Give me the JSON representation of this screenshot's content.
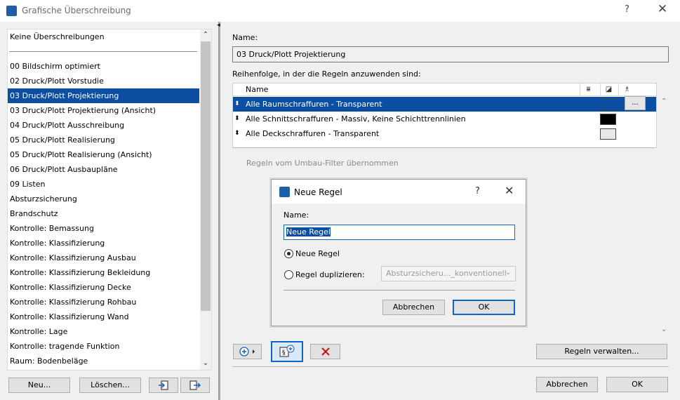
{
  "window": {
    "title": "Grafische Überschreibung",
    "help_label": "?",
    "close_label": "✕"
  },
  "left_panel": {
    "items": [
      "Keine Überschreibungen",
      "00 Bildschirm optimiert",
      "02 Druck/Plott Vorstudie",
      "03 Druck/Plott Projektierung",
      "03 Druck/Plott Projektierung (Ansicht)",
      "04 Druck/Plott Ausschreibung",
      "05 Druck/Plott Realisierung",
      "05 Druck/Plott Realisierung (Ansicht)",
      "06 Druck/Plott Ausbaupläne",
      "09 Listen",
      "Absturzsicherung",
      "Brandschutz",
      "Kontrolle: Bemassung",
      "Kontrolle: Klassifizierung",
      "Kontrolle: Klassifizierung Ausbau",
      "Kontrolle: Klassifizierung Bekleidung",
      "Kontrolle: Klassifizierung Decke",
      "Kontrolle: Klassifizierung Rohbau",
      "Kontrolle: Klassifizierung Wand",
      "Kontrolle: Lage",
      "Kontrolle: tragende Funktion",
      "Raum: Bodenbeläge"
    ],
    "selected_index": 3,
    "buttons": {
      "new": "Neu...",
      "delete": "Löschen..."
    }
  },
  "right_panel": {
    "name_label": "Name:",
    "name_value": "03 Druck/Plott Projektierung",
    "order_label": "Reihenfolge, in der die Regeln anzuwenden sind:",
    "table": {
      "header_name": "Name",
      "rows": [
        {
          "label": "Alle Raumschraffuren - Transparent",
          "swatch": "#0c4ea2"
        },
        {
          "label": "Alle Schnittschraffuren - Massiv, Keine Schichttrennlinien",
          "swatch": "#000000"
        },
        {
          "label": "Alle Deckschraffuren - Transparent",
          "swatch": "#e8e8e8"
        }
      ],
      "selected_index": 0,
      "more_label": "..."
    },
    "inherited_label": "Regeln vom Umbau-Filter übernommen",
    "manage_rules": "Regeln verwalten...",
    "cancel": "Abbrechen",
    "ok": "OK"
  },
  "modal": {
    "title": "Neue Regel",
    "help_label": "?",
    "close_label": "✕",
    "name_label": "Name:",
    "name_value": "Neue Regel",
    "option_new": "Neue Regel",
    "option_duplicate": "Regel duplizieren:",
    "duplicate_select": "Absturzsicheru..._konventionell",
    "cancel": "Abbrechen",
    "ok": "OK"
  },
  "colors": {
    "selection": "#0c4ea2",
    "accent_border": "#0a67c8",
    "delete_red": "#d01010"
  }
}
